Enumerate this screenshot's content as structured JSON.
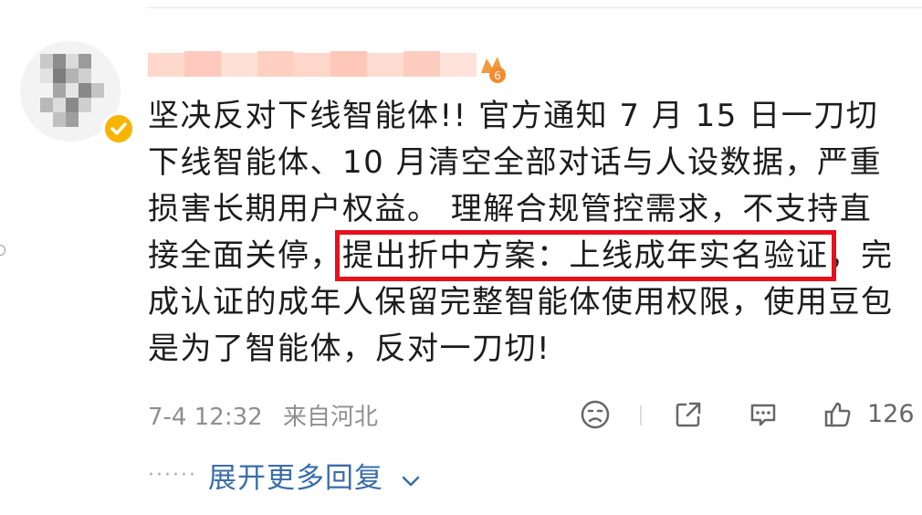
{
  "comment": {
    "line1": "坚决反对下线智能体!! 官方通知 7 月 15 日一刀切",
    "line2": "下线智能体、10 月清空全部对话与人设数据，严重",
    "line3": "损害长期用户权益。 理解合规管控需求，不支持直",
    "line4_pre": "接全面关停，",
    "line4_highlight": "提出折中方案：上线成年实名验证",
    "line4_post": "，完",
    "line5": "成认证的成年人保留完整智能体使用权限，使用豆包",
    "line6": "是为了智能体，反对一刀切!"
  },
  "meta": {
    "timestamp": "7-4 12:32",
    "location": "来自河北"
  },
  "actions": {
    "like_count": "126",
    "icons": [
      "emoji-icon",
      "share-icon",
      "comment-icon",
      "like-icon"
    ]
  },
  "replies": {
    "dots": "······",
    "expand_label": "展开更多回复"
  },
  "colors": {
    "highlight_border": "#e8101b",
    "link": "#3a6ea8",
    "verified": "#f7b500",
    "meta_text": "#8f8f8f"
  }
}
